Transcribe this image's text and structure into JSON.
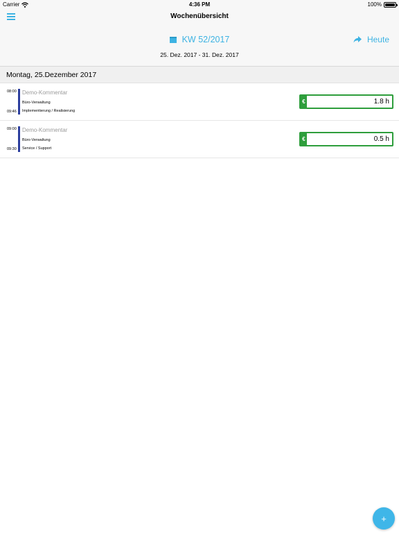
{
  "status_bar": {
    "carrier": "Carrier",
    "time": "4:36 PM",
    "battery": "100%"
  },
  "header": {
    "title": "Wochenübersicht",
    "week_label": "KW 52/2017",
    "today_label": "Heute",
    "date_range": "25. Dez. 2017 - 31. Dez. 2017"
  },
  "colors": {
    "accent": "#3db3e3",
    "billable_green": "#2e9e3c",
    "entry_bar": "#2c3e9e"
  },
  "day": {
    "title": "Montag, 25.Dezember 2017",
    "entries": [
      {
        "start": "08:00",
        "end": "09:46",
        "comment": "Demo-Kommentar",
        "project": "Büro-Verwaltung",
        "activity": "Implementierung / Realisierung",
        "currency_symbol": "€",
        "hours": "1.8 h"
      },
      {
        "start": "09:00",
        "end": "09:30",
        "comment": "Demo-Kommentar",
        "project": "Büro-Verwaltung",
        "activity": "Service / Support",
        "currency_symbol": "€",
        "hours": "0.5 h"
      }
    ]
  },
  "fab": {
    "label": "+"
  },
  "icons": [
    "wifi-icon",
    "battery-icon",
    "menu-icon",
    "calendar-icon",
    "share-arrow-icon",
    "plus-icon"
  ]
}
